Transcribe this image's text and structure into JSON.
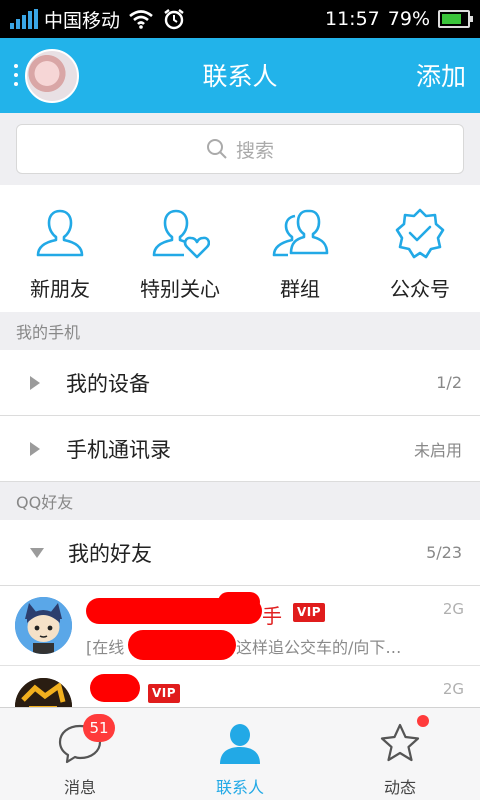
{
  "status_bar": {
    "carrier": "中国移动",
    "time": "11:57",
    "battery": "79%",
    "battery_level": 0.79
  },
  "nav": {
    "title": "联系人",
    "add_label": "添加"
  },
  "search": {
    "placeholder": "搜索"
  },
  "quick_actions": [
    {
      "label": "新朋友",
      "icon": "person-icon"
    },
    {
      "label": "特别关心",
      "icon": "person-heart-icon"
    },
    {
      "label": "群组",
      "icon": "group-icon"
    },
    {
      "label": "公众号",
      "icon": "badge-check-icon"
    }
  ],
  "sections": {
    "my_phone": "我的手机",
    "qq_friends": "QQ好友"
  },
  "my_phone_rows": [
    {
      "name": "我的设备",
      "count": "1/2"
    },
    {
      "name": "手机通讯录",
      "count": "未启用"
    }
  ],
  "friend_group": {
    "name": "我的好友",
    "count": "5/23"
  },
  "friends": [
    {
      "name_visible": "手",
      "vip": "VIP",
      "network": "2G",
      "status_start": "[在线",
      "status_end": "这样追公交车的/向下…"
    },
    {
      "name_visible": "",
      "vip": "VIP",
      "network": "2G",
      "status_start": "",
      "status_end": ""
    }
  ],
  "tabs": [
    {
      "label": "消息",
      "badge": "51"
    },
    {
      "label": "联系人",
      "active": true
    },
    {
      "label": "动态",
      "dot": true
    }
  ],
  "colors": {
    "accent": "#22b3ea",
    "badge": "#ff3b3b",
    "vip": "#e01c1c",
    "redaction": "#ff0000"
  }
}
